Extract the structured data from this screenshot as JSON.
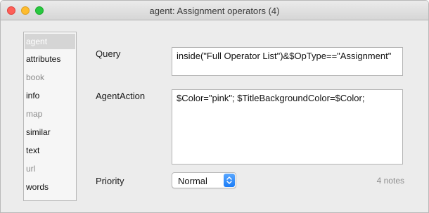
{
  "window": {
    "title": "agent: Assignment operators (4)"
  },
  "sidebar": {
    "items": [
      {
        "label": "agent",
        "selected": true,
        "dim": false
      },
      {
        "label": "attributes",
        "selected": false,
        "dim": false
      },
      {
        "label": "book",
        "selected": false,
        "dim": true
      },
      {
        "label": "info",
        "selected": false,
        "dim": false
      },
      {
        "label": "map",
        "selected": false,
        "dim": true
      },
      {
        "label": "similar",
        "selected": false,
        "dim": false
      },
      {
        "label": "text",
        "selected": false,
        "dim": false
      },
      {
        "label": "url",
        "selected": false,
        "dim": true
      },
      {
        "label": "words",
        "selected": false,
        "dim": false
      }
    ]
  },
  "form": {
    "query_label": "Query",
    "query_value": "inside(\"Full Operator List\")&$OpType==\"Assignment\"",
    "agent_action_label": "AgentAction",
    "agent_action_value": "$Color=\"pink\"; $TitleBackgroundColor=$Color;",
    "priority_label": "Priority",
    "priority_value": "Normal",
    "notes_count": "4 notes"
  },
  "colors": {
    "selection_background": "#d5d5d5",
    "stepper_accent": "#1a7cf7"
  }
}
